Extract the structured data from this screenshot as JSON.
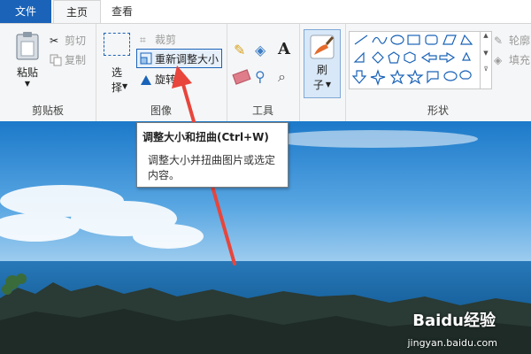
{
  "tabs": {
    "file": "文件",
    "home": "主页",
    "view": "查看"
  },
  "clipboard": {
    "paste": "粘贴",
    "cut": "剪切",
    "copy": "复制",
    "label": "剪贴板"
  },
  "image": {
    "select_top": "选",
    "select_bottom": "择",
    "crop": "裁剪",
    "resize": "重新调整大小",
    "rotate": "旋转",
    "label": "图像"
  },
  "tools": {
    "label": "工具",
    "text_tool": "A"
  },
  "brushes": {
    "top": "刷",
    "bottom": "子"
  },
  "shapes": {
    "label": "形状",
    "outline": "轮廓",
    "fill": "填充"
  },
  "tooltip": {
    "title": "调整大小和扭曲(Ctrl+W)",
    "body_line1": "调整大小并扭曲图片或选定",
    "body_line2": "内容。"
  },
  "watermark": {
    "brand": "Baidu经验",
    "url": "jingyan.baidu.com"
  },
  "colors": {
    "accent": "#1a63b8",
    "arrow": "#e8453c",
    "sea": "#1f6fb0"
  }
}
